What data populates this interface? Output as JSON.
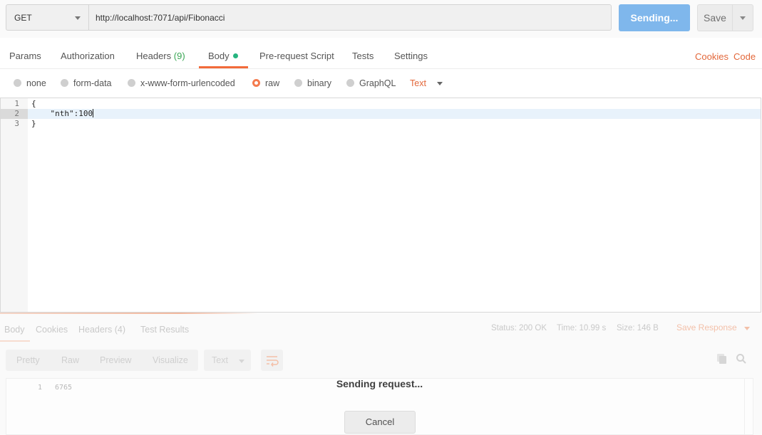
{
  "request": {
    "method": "GET",
    "url": "http://localhost:7071/api/Fibonacci",
    "send_label": "Sending...",
    "save_label": "Save"
  },
  "tabs": {
    "params": "Params",
    "authorization": "Authorization",
    "headers": "Headers",
    "headers_count": "(9)",
    "body": "Body",
    "pre_request": "Pre-request Script",
    "tests": "Tests",
    "settings": "Settings",
    "active": "Body"
  },
  "links": {
    "cookies": "Cookies",
    "code": "Code"
  },
  "body_types": {
    "none": "none",
    "form_data": "form-data",
    "urlencoded": "x-www-form-urlencoded",
    "raw": "raw",
    "binary": "binary",
    "graphql": "GraphQL",
    "selected": "raw",
    "format": "Text"
  },
  "editor": {
    "lines": [
      "{",
      "    \"nth\":100",
      "}"
    ],
    "line_numbers": [
      "1",
      "2",
      "3"
    ],
    "active_line": "2"
  },
  "response": {
    "tabs": {
      "body": "Body",
      "cookies": "Cookies",
      "headers": "Headers",
      "headers_count": "(4)",
      "test_results": "Test Results"
    },
    "status": "Status: 200 OK",
    "time": "Time: 10.99 s",
    "size": "Size: 146 B",
    "save_response": "Save Response",
    "view_options": {
      "pretty": "Pretty",
      "raw": "Raw",
      "preview": "Preview",
      "visualize": "Visualize"
    },
    "format": "Text",
    "line_number": "1",
    "value": "6765"
  },
  "overlay": {
    "message": "Sending request...",
    "cancel": "Cancel"
  },
  "colors": {
    "accent": "#f26b3a",
    "send_button": "#7fb7ec",
    "active_dot": "#26b47f",
    "header_count": "#3aa655"
  },
  "icons": [
    "caret-down-icon",
    "radio-icon",
    "wrap-lines-icon",
    "copy-icon",
    "search-icon"
  ]
}
